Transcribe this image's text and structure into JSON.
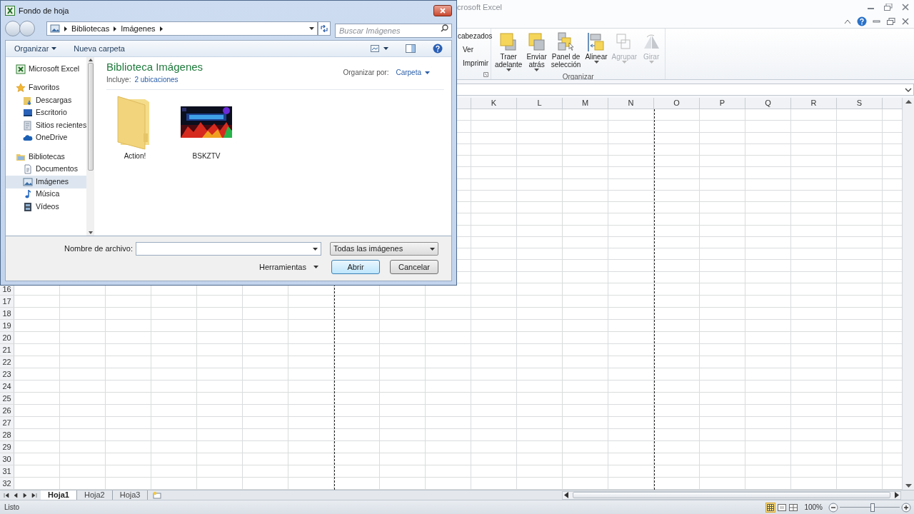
{
  "excel": {
    "title": "crosoft Excel",
    "ribbon": {
      "partial_items": [
        "cabezados",
        "Ver",
        "Imprimir"
      ],
      "group": {
        "label": "Organizar",
        "buttons": [
          {
            "lines": [
              "Traer",
              "adelante"
            ],
            "kind": "front",
            "dropdown": true,
            "disabled": false
          },
          {
            "lines": [
              "Enviar",
              "atrás"
            ],
            "kind": "back",
            "dropdown": true,
            "disabled": false
          },
          {
            "lines": [
              "Panel de",
              "selección"
            ],
            "kind": "pane",
            "dropdown": false,
            "disabled": false
          },
          {
            "lines": [
              "Alinear"
            ],
            "kind": "align",
            "dropdown": true,
            "disabled": false
          },
          {
            "lines": [
              "Agrupar"
            ],
            "kind": "group",
            "dropdown": true,
            "disabled": true
          },
          {
            "lines": [
              "Girar"
            ],
            "kind": "rotate",
            "dropdown": true,
            "disabled": true
          }
        ]
      }
    },
    "columns": [
      "K",
      "L",
      "M",
      "N",
      "O",
      "P",
      "Q",
      "R",
      "S"
    ],
    "rows": [
      "16",
      "17",
      "18",
      "19",
      "20",
      "21",
      "22",
      "23",
      "24",
      "25",
      "26",
      "27",
      "28",
      "29",
      "30",
      "31",
      "32"
    ],
    "sheets": [
      {
        "name": "Hoja1",
        "selected": true
      },
      {
        "name": "Hoja2",
        "selected": false
      },
      {
        "name": "Hoja3",
        "selected": false
      }
    ],
    "status": "Listo",
    "zoom": {
      "reading": "100%",
      "level": 0.55
    }
  },
  "dialog": {
    "title": "Fondo de hoja",
    "breadcrumb": [
      "Bibliotecas",
      "Imágenes"
    ],
    "search": {
      "placeholder": "Buscar Imágenes"
    },
    "toolbar": {
      "organize": "Organizar",
      "new_folder": "Nueva carpeta"
    },
    "nav": [
      {
        "label": "Microsoft Excel",
        "kind": "excel",
        "selected": false
      },
      {
        "label": "Favoritos",
        "kind": "star",
        "selected": false,
        "children": [
          {
            "label": "Descargas",
            "kind": "downloads",
            "selected": false
          },
          {
            "label": "Escritorio",
            "kind": "desktop",
            "selected": false
          },
          {
            "label": "Sitios recientes",
            "kind": "recent",
            "selected": false
          },
          {
            "label": "OneDrive",
            "kind": "cloud",
            "selected": false
          }
        ]
      },
      {
        "label": "Bibliotecas",
        "kind": "libraries",
        "selected": false,
        "children": [
          {
            "label": "Documentos",
            "kind": "documents",
            "selected": false
          },
          {
            "label": "Imágenes",
            "kind": "pictures",
            "selected": true
          },
          {
            "label": "Música",
            "kind": "music",
            "selected": false
          },
          {
            "label": "Vídeos",
            "kind": "videos",
            "selected": false
          }
        ]
      }
    ],
    "library": {
      "title": "Biblioteca Imágenes",
      "includes_label": "Incluye:",
      "includes_link": "2 ubicaciones",
      "arrange_label": "Organizar por:",
      "arrange_value": "Carpeta"
    },
    "items": [
      {
        "name": "Action!",
        "kind": "folder"
      },
      {
        "name": "BSKZTV",
        "kind": "picture"
      }
    ],
    "filename_label": "Nombre de archivo:",
    "filter": "Todas las imágenes",
    "tools": "Herramientas",
    "buttons": [
      {
        "label": "Abrir",
        "kind": "default"
      },
      {
        "label": "Cancelar",
        "kind": "normal"
      }
    ]
  }
}
